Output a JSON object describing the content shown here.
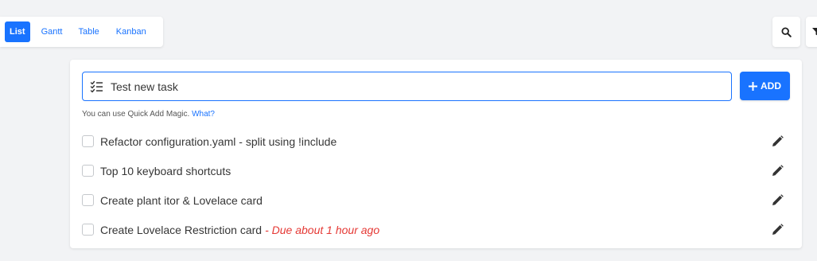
{
  "views": {
    "list": "List",
    "gantt": "Gantt",
    "table": "Table",
    "kanban": "Kanban"
  },
  "toolbar": {
    "search_icon": "search-icon",
    "filter_icon": "filter-icon"
  },
  "new_task": {
    "value": "Test new task",
    "add_label": "ADD",
    "hint_text": "You can use Quick Add Magic.",
    "hint_link": "What?"
  },
  "tasks": [
    {
      "title": "Refactor configuration.yaml - split using !include",
      "due": ""
    },
    {
      "title": "Top 10 keyboard shortcuts",
      "due": ""
    },
    {
      "title": "Create plant itor & Lovelace card",
      "due": ""
    },
    {
      "title": "Create Lovelace Restriction card",
      "due": "- Due about 1 hour ago"
    }
  ],
  "colors": {
    "primary": "#1973ff",
    "due_overdue": "#e53935",
    "background": "#f2f3f5"
  }
}
